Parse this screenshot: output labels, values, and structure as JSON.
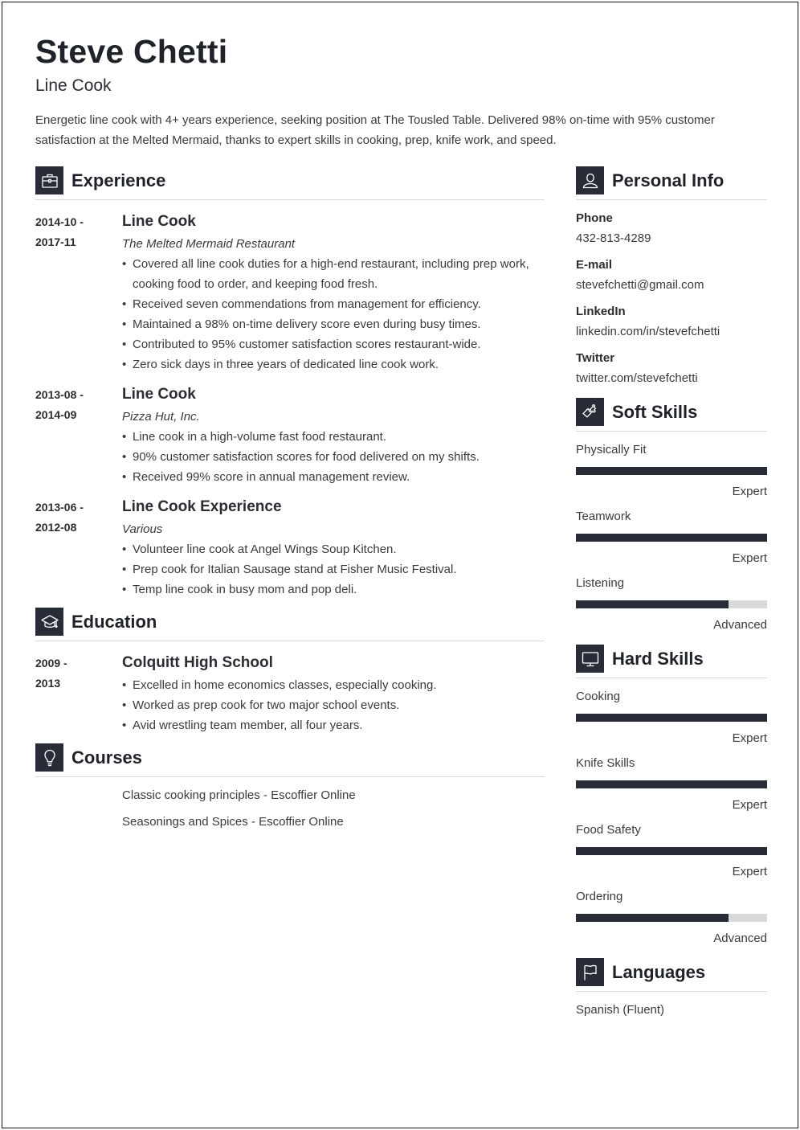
{
  "header": {
    "name": "Steve Chetti",
    "role": "Line Cook",
    "summary": "Energetic line cook with 4+ years experience, seeking position at The Tousled Table. Delivered 98% on-time with 95% customer satisfaction at the Melted Mermaid, thanks to expert skills in cooking, prep, knife work, and speed."
  },
  "experience": {
    "title": "Experience",
    "icon": "briefcase-icon",
    "entries": [
      {
        "date_start": "2014-10 -",
        "date_end": "2017-11",
        "title": "Line Cook",
        "org": "The Melted Mermaid Restaurant",
        "bullets": [
          "Covered all line cook duties for a high-end restaurant, including prep work, cooking food to order, and keeping food fresh.",
          "Received seven commendations from management for efficiency.",
          "Maintained a 98% on-time delivery score even during busy times.",
          "Contributed to 95% customer satisfaction scores restaurant-wide.",
          "Zero sick days in three years of dedicated line cook work."
        ]
      },
      {
        "date_start": "2013-08 -",
        "date_end": "2014-09",
        "title": "Line Cook",
        "org": "Pizza Hut, Inc.",
        "bullets": [
          "Line cook in a high-volume fast food restaurant.",
          "90% customer satisfaction scores for food delivered on my shifts.",
          "Received 99% score in annual management review."
        ]
      },
      {
        "date_start": "2013-06 -",
        "date_end": "2012-08",
        "title": "Line Cook Experience",
        "org": "Various",
        "bullets": [
          "Volunteer line cook at Angel Wings Soup Kitchen.",
          "Prep cook for Italian Sausage stand at Fisher Music Festival.",
          "Temp line cook in busy mom and pop deli."
        ]
      }
    ]
  },
  "education": {
    "title": "Education",
    "icon": "graduation-cap-icon",
    "entries": [
      {
        "date_start": "2009 -",
        "date_end": "2013",
        "title": "Colquitt High School",
        "bullets": [
          "Excelled in home economics classes, especially cooking.",
          "Worked as prep cook for two major school events.",
          "Avid wrestling team member, all four years."
        ]
      }
    ]
  },
  "courses": {
    "title": "Courses",
    "icon": "lightbulb-icon",
    "items": [
      "Classic cooking principles - Escoffier Online",
      "Seasonings and Spices - Escoffier Online"
    ]
  },
  "personal_info": {
    "title": "Personal Info",
    "icon": "user-icon",
    "fields": [
      {
        "label": "Phone",
        "value": "432-813-4289"
      },
      {
        "label": "E-mail",
        "value": "stevefchetti@gmail.com"
      },
      {
        "label": "LinkedIn",
        "value": "linkedin.com/in/stevefchetti"
      },
      {
        "label": "Twitter",
        "value": "twitter.com/stevefchetti"
      }
    ]
  },
  "soft_skills": {
    "title": "Soft Skills",
    "icon": "puzzle-piece-icon",
    "items": [
      {
        "name": "Physically Fit",
        "level": "Expert",
        "fill": 1.0
      },
      {
        "name": "Teamwork",
        "level": "Expert",
        "fill": 1.0
      },
      {
        "name": "Listening",
        "level": "Advanced",
        "fill": 0.8
      }
    ]
  },
  "hard_skills": {
    "title": "Hard Skills",
    "icon": "monitor-icon",
    "items": [
      {
        "name": "Cooking",
        "level": "Expert",
        "fill": 1.0
      },
      {
        "name": "Knife Skills",
        "level": "Expert",
        "fill": 1.0
      },
      {
        "name": "Food Safety",
        "level": "Expert",
        "fill": 1.0
      },
      {
        "name": "Ordering",
        "level": "Advanced",
        "fill": 0.8
      }
    ]
  },
  "languages": {
    "title": "Languages",
    "icon": "flag-icon",
    "items": [
      "Spanish (Fluent)"
    ]
  },
  "colors": {
    "accent": "#272c37",
    "bar_track": "#d9d9d9",
    "divider": "#d8d8d8"
  }
}
